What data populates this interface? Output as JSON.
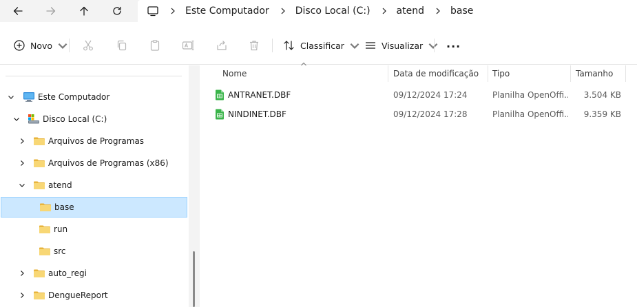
{
  "address_bar": {
    "breadcrumb": [
      "Este Computador",
      "Disco Local (C:)",
      "atend",
      "base"
    ]
  },
  "command_bar": {
    "new_label": "Novo",
    "sort_label": "Classificar",
    "view_label": "Visualizar",
    "more_label": "..."
  },
  "sidebar": {
    "items": [
      {
        "label": "Este Computador",
        "icon": "computer-icon",
        "level": 0,
        "expanded": true
      },
      {
        "label": "Disco Local (C:)",
        "icon": "drive-icon",
        "level": 1,
        "expanded": true
      },
      {
        "label": "Arquivos de Programas",
        "icon": "folder-icon",
        "level": 2,
        "expanded": false
      },
      {
        "label": "Arquivos de Programas (x86)",
        "icon": "folder-icon",
        "level": 2,
        "expanded": false
      },
      {
        "label": "atend",
        "icon": "folder-icon",
        "level": 2,
        "expanded": true
      },
      {
        "label": "base",
        "icon": "folder-icon",
        "level": 3,
        "selected": true
      },
      {
        "label": "run",
        "icon": "folder-icon",
        "level": 3
      },
      {
        "label": "src",
        "icon": "folder-icon",
        "level": 3
      },
      {
        "label": "auto_regi",
        "icon": "folder-icon",
        "level": 2,
        "expanded": false
      },
      {
        "label": "DengueReport",
        "icon": "folder-icon",
        "level": 2,
        "expanded": false
      }
    ]
  },
  "file_list": {
    "columns": [
      "Nome",
      "Data de modificação",
      "Tipo",
      "Tamanho"
    ],
    "rows": [
      {
        "name": "ANTRANET.DBF",
        "modified": "09/12/2024 17:24",
        "type": "Planilha OpenOffi...",
        "size": "3.504 KB"
      },
      {
        "name": "NINDINET.DBF",
        "modified": "09/12/2024 17:28",
        "type": "Planilha OpenOffi...",
        "size": "9.359 KB"
      }
    ]
  },
  "colors": {
    "selection_bg": "#cce8ff",
    "selection_border": "#99d1ff",
    "folder": "#f8d775",
    "spreadsheet_icon": "#3ab44a"
  }
}
